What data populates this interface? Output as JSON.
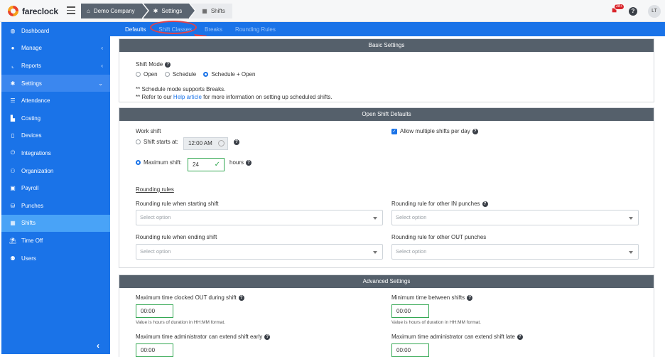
{
  "app": {
    "brand": "fareclock"
  },
  "breadcrumb": [
    {
      "label": "Demo Company",
      "icon": "home-icon"
    },
    {
      "label": "Settings",
      "icon": "gear-icon"
    },
    {
      "label": "Shifts",
      "icon": "calendar-icon"
    }
  ],
  "header": {
    "notifications_count": "28+",
    "help": "?",
    "avatar_initials": "LT"
  },
  "sidebar": {
    "items": [
      {
        "label": "Dashboard",
        "icon": "dashboard-icon",
        "glyph": "◍"
      },
      {
        "label": "Manage",
        "icon": "user-icon",
        "glyph": "●",
        "chevron": "‹"
      },
      {
        "label": "Reports",
        "icon": "chart-icon",
        "glyph": "⌞",
        "chevron": "‹"
      },
      {
        "label": "Settings",
        "icon": "gear-icon",
        "glyph": "✱",
        "chevron": "⌄"
      },
      {
        "label": "Attendance",
        "icon": "attendance-icon",
        "glyph": "☰"
      },
      {
        "label": "Costing",
        "icon": "costing-icon",
        "glyph": "▙"
      },
      {
        "label": "Devices",
        "icon": "device-icon",
        "glyph": "▯"
      },
      {
        "label": "Integrations",
        "icon": "plug-icon",
        "glyph": "⏻"
      },
      {
        "label": "Organization",
        "icon": "org-icon",
        "glyph": "⚇"
      },
      {
        "label": "Payroll",
        "icon": "payroll-icon",
        "glyph": "▣"
      },
      {
        "label": "Punches",
        "icon": "punch-icon",
        "glyph": "⛁"
      },
      {
        "label": "Shifts",
        "icon": "calendar-icon",
        "glyph": "▦"
      },
      {
        "label": "Time Off",
        "icon": "beach-icon",
        "glyph": "⛱"
      },
      {
        "label": "Users",
        "icon": "users-icon",
        "glyph": "⚉"
      }
    ],
    "collapse": "‹"
  },
  "tabs": [
    {
      "label": "Defaults"
    },
    {
      "label": "Shift Classes"
    },
    {
      "label": "Breaks"
    },
    {
      "label": "Rounding Rules"
    }
  ],
  "basic": {
    "title": "Basic Settings",
    "shift_mode_label": "Shift Mode",
    "options": [
      "Open",
      "Schedule",
      "Schedule + Open"
    ],
    "selected": "Schedule + Open",
    "note1": "** Schedule mode supports Breaks.",
    "note2_pre": "** Refer to our ",
    "note2_link": "Help article",
    "note2_post": " for more information on setting up scheduled shifts."
  },
  "open": {
    "title": "Open Shift Defaults",
    "work_shift": "Work shift",
    "starts_at_label": "Shift starts at:",
    "starts_at_value": "12:00 AM",
    "max_shift_label": "Maximum shift:",
    "max_shift_value": "24",
    "hours": "hours",
    "allow_multiple": "Allow multiple shifts per day",
    "rounding_title": "Rounding rules",
    "r_start": "Rounding rule when starting shift",
    "r_in": "Rounding rule for other IN punches",
    "r_end": "Rounding rule when ending shift",
    "r_out": "Rounding rule for other OUT punches",
    "select_placeholder": "Select option"
  },
  "advanced": {
    "title": "Advanced Settings",
    "max_out": "Maximum time clocked OUT during shift",
    "min_between": "Minimum time between shifts",
    "value": "00:00",
    "hint": "Value is hours of duration in HH:MM format.",
    "extend_early": "Maximum time administrator can extend shift early",
    "extend_late": "Maximum time administrator can extend shift late"
  },
  "colors": {
    "primary": "#1a73e8",
    "sidebar_active": "#49a3f7",
    "panel_header": "#55606b",
    "success": "#34a853",
    "annotation": "#e0424b"
  }
}
